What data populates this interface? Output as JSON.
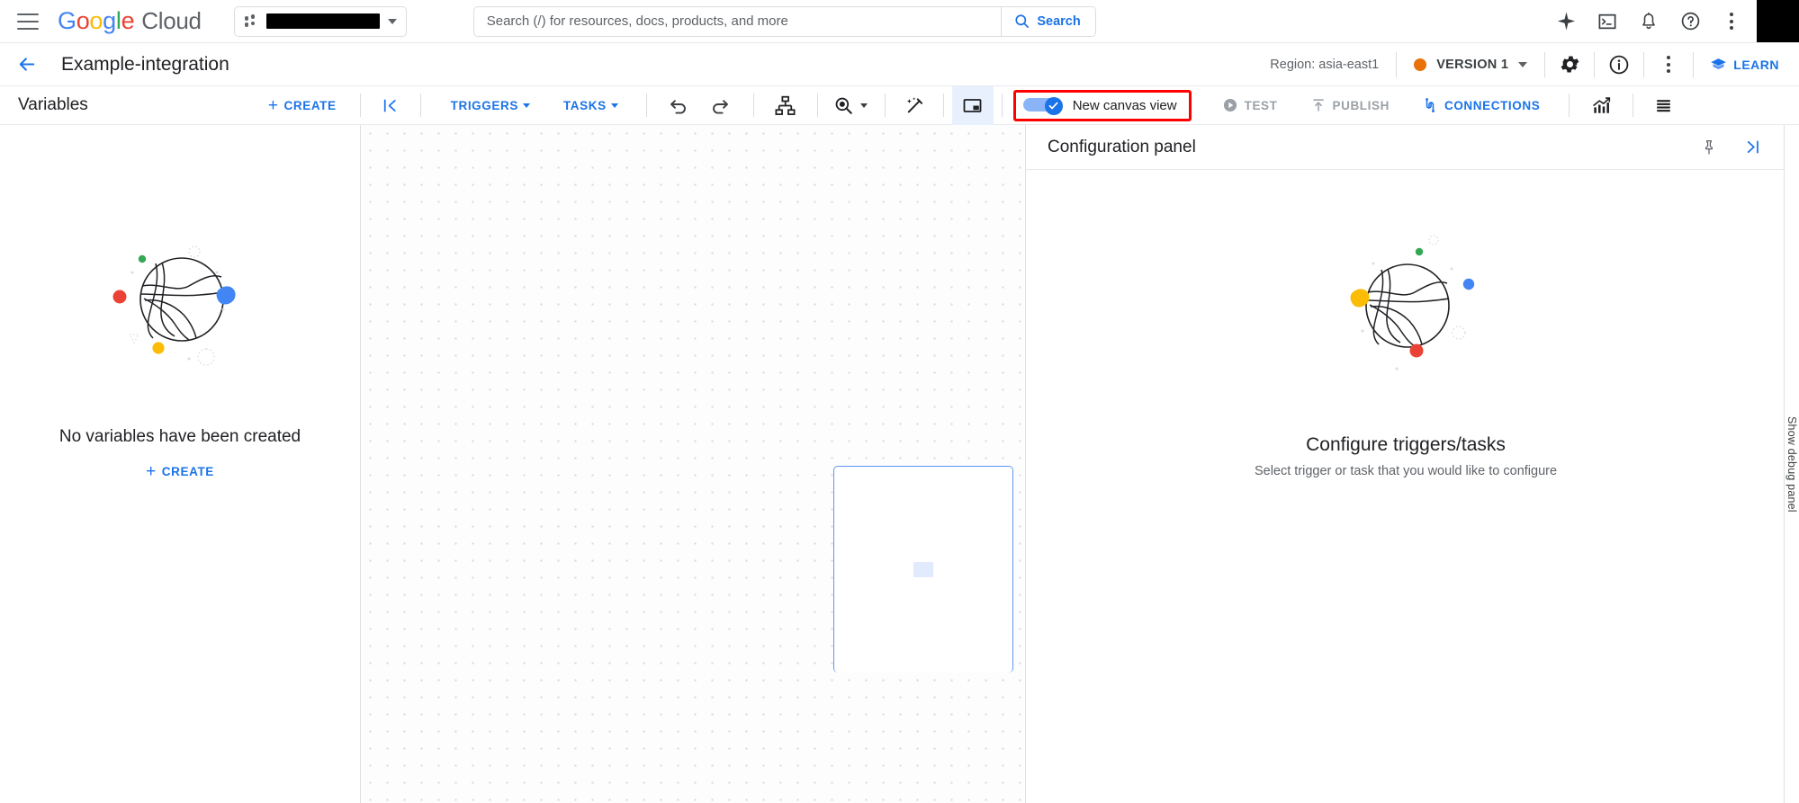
{
  "topbar": {
    "menu_icon": "hamburger-menu-icon",
    "brand": {
      "google": "Google",
      "cloud": "Cloud"
    },
    "project_picker": {
      "value": "",
      "redacted": true,
      "icon": "project-dots-icon"
    },
    "search": {
      "placeholder": "Search (/) for resources, docs, products, and more",
      "value": "",
      "button_label": "Search",
      "icon": "search-icon"
    },
    "icons": [
      {
        "name": "gemini-sparkle-icon",
        "label": "Gemini"
      },
      {
        "name": "cloud-shell-icon",
        "label": "Activate Cloud Shell"
      },
      {
        "name": "notifications-bell-icon",
        "label": "Notifications"
      },
      {
        "name": "help-icon",
        "label": "Help"
      },
      {
        "name": "more-options-kebab-icon",
        "label": "More options"
      }
    ],
    "avatar": {
      "name": "account-avatar",
      "redacted": true
    }
  },
  "pageheader": {
    "back_icon": "back-arrow-icon",
    "title": "Example-integration",
    "region": "Region: asia-east1",
    "version": {
      "label": "VERSION 1",
      "status_color": "#e8710a"
    },
    "settings_icon": "gear-icon",
    "info_icon": "info-icon",
    "more_icon": "more-options-kebab-icon",
    "learn": {
      "label": "LEARN",
      "icon": "learn-icon"
    }
  },
  "toolbar": {
    "variables_title": "Variables",
    "create_label": "CREATE",
    "collapse_icon": "collapse-left-icon",
    "triggers_label": "TRIGGERS",
    "tasks_label": "TASKS",
    "undo_icon": "undo-icon",
    "redo_icon": "redo-icon",
    "layout_icon": "auto-layout-icon",
    "zoom_icon": "zoom-in-icon",
    "magic_icon": "magic-wand-icon",
    "pip_icon": "picture-in-picture-icon",
    "canvas_toggle": {
      "label": "New canvas view",
      "checked": true,
      "highlight_color": "#ff0000",
      "on_color": "#1a73e8"
    },
    "test_label": "TEST",
    "publish_label": "PUBLISH",
    "connections_label": "CONNECTIONS",
    "analytics_icon": "analytics-chart-icon",
    "logs_icon": "logs-list-icon"
  },
  "left_panel": {
    "empty_message": "No variables have been created",
    "create_label": "CREATE",
    "illustration": "empty-state-globe-illustration"
  },
  "canvas": {
    "node_placeholder": "canvas-node-placeholder"
  },
  "config_panel": {
    "title": "Configuration panel",
    "pin_icon": "pin-icon",
    "collapse_icon": "collapse-right-icon",
    "empty_title": "Configure triggers/tasks",
    "empty_subtitle": "Select trigger or task that you would like to configure",
    "illustration": "empty-state-globe-illustration"
  },
  "debug_panel": {
    "label": "Show debug panel"
  },
  "colors": {
    "accent_blue": "#1a73e8",
    "text_primary": "#202124",
    "text_secondary": "#5f6368",
    "border": "#dadce0",
    "google_red": "#EA4335",
    "google_yellow": "#FBBC05",
    "google_green": "#34A853",
    "google_blue": "#4285F4",
    "version_orange": "#e8710a",
    "highlight_red": "#ff0000"
  }
}
